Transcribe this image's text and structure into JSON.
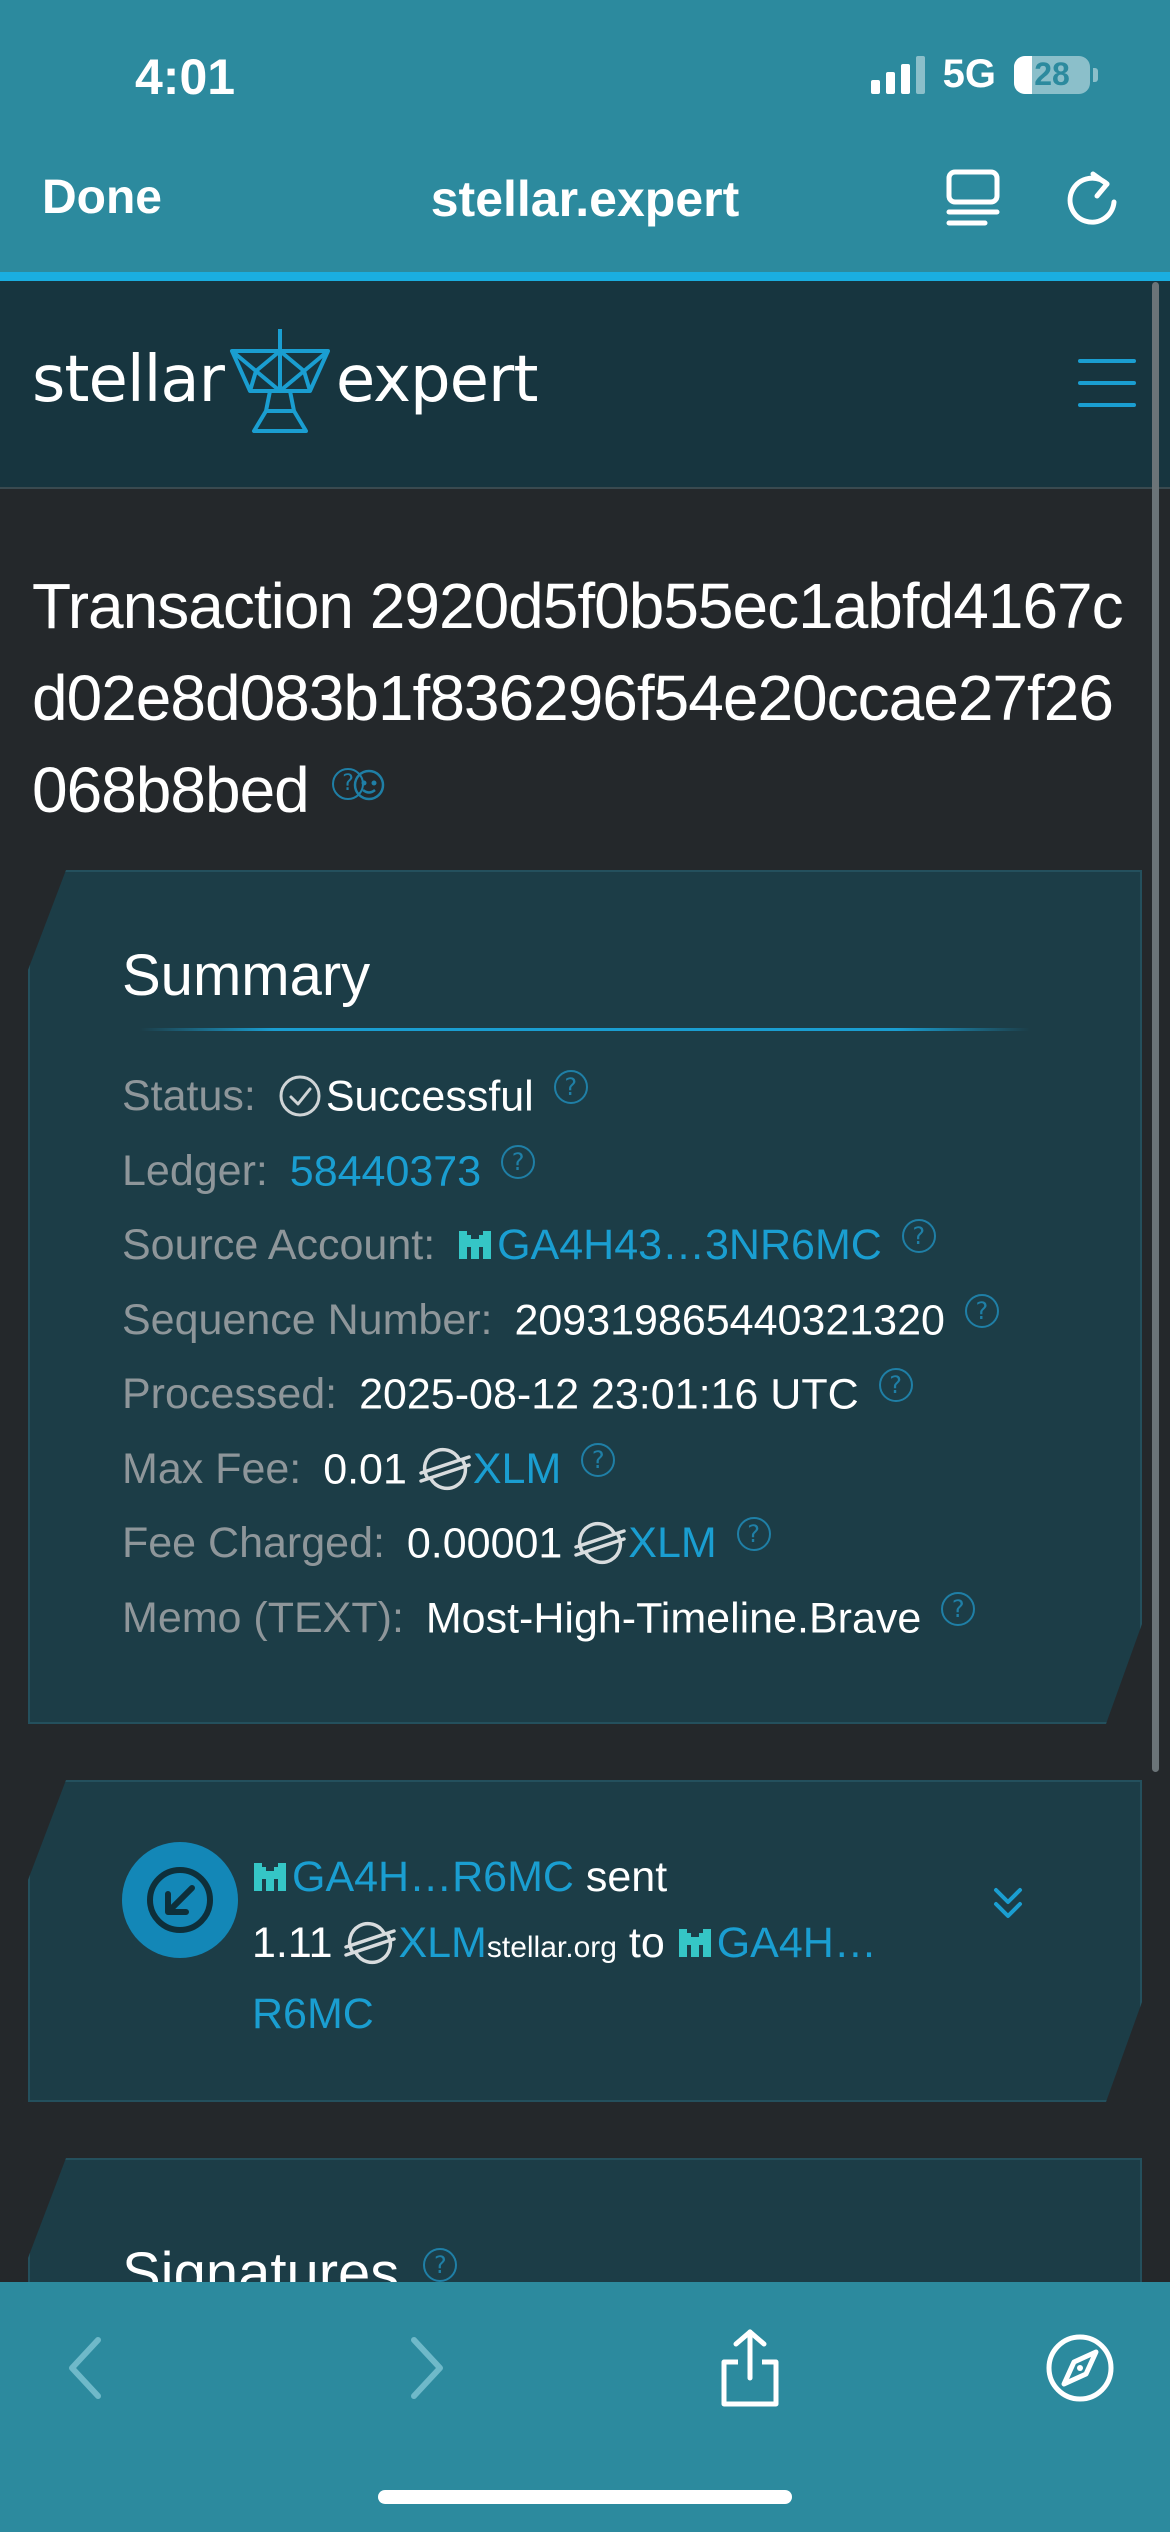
{
  "status_bar": {
    "time": "4:01",
    "network": "5G",
    "battery": "28"
  },
  "browser": {
    "done_label": "Done",
    "domain": "stellar.expert"
  },
  "site": {
    "logo_left": "stellar",
    "logo_right": "expert"
  },
  "page": {
    "title": "Transaction 2920d5f0b55ec1abfd4167cd02e8d083b1f836296f54e20ccae27f26068b8bed"
  },
  "summary": {
    "heading": "Summary",
    "rows": [
      {
        "label": "Status:",
        "value": "Successful"
      },
      {
        "label": "Ledger:",
        "value": "58440373"
      },
      {
        "label": "Source Account:",
        "value": "GA4H43…3NR6MC"
      },
      {
        "label": "Sequence Number:",
        "value": "209319865440321320"
      },
      {
        "label": "Processed:",
        "value": "2025-08-12 23:01:16 UTC"
      },
      {
        "label": "Max Fee:",
        "amount": "0.01",
        "asset": "XLM"
      },
      {
        "label": "Fee Charged:",
        "amount": "0.00001",
        "asset": "XLM"
      },
      {
        "label": "Memo (TEXT):",
        "value": "Most-High-Timeline.Brave"
      }
    ]
  },
  "operation": {
    "from": "GA4H…R6MC",
    "verb": "sent",
    "amount": "1.11",
    "asset": "XLM",
    "asset_domain": "stellar.org",
    "to_word": "to",
    "to_line1": "GA4H…",
    "to_line2": "R6MC"
  },
  "signatures": {
    "heading": "Signatures"
  },
  "help_glyph": "?",
  "colors": {
    "link": "#1a9ed1",
    "panel": "#1c3d47",
    "safari_bar": "#2c8a9e",
    "background": "#24282b"
  }
}
